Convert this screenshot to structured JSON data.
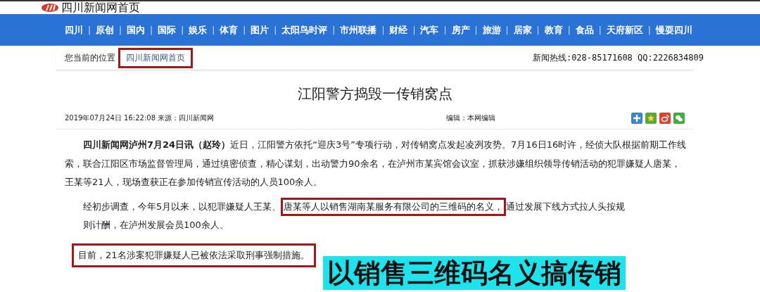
{
  "header": {
    "site_title": "四川新闻网首页"
  },
  "nav": {
    "items": [
      "四川",
      "原创",
      "国内",
      "国际",
      "娱乐",
      "体育",
      "图片",
      "太阳鸟时评",
      "市州联播",
      "财经",
      "汽车",
      "房产",
      "旅游",
      "居家",
      "教育",
      "食品",
      "天府新区",
      "慢耍四川"
    ],
    "separator": "|"
  },
  "breadcrumb": {
    "label": "您当前的位置",
    "link": "四川新闻网首页",
    "boxed": true,
    "hotline": "新闻热线:028-85171608 QQ:2226834809"
  },
  "article": {
    "title": "江阳警方捣毁一传销窝点",
    "published": "2019年07月24日 16:22:08 来源：四川新闻网",
    "editor": "编辑：本网编辑",
    "share_icons": [
      {
        "kind": "add",
        "color": "#3a86c8"
      },
      {
        "kind": "star",
        "color": "#5aa83a"
      },
      {
        "kind": "weibo",
        "color": "#d9442f"
      },
      {
        "kind": "wechat",
        "color": "#3fae3a"
      }
    ],
    "lead": "**四川新闻网泸州7月24日讯（赵玲）**近日，江阳警方依托“迎庆3号”专项行动，对传销窝点发起凌冽攻势。7月16日16时许，经侦大队根据前期工作线索，联合江阳区市场监督管理局，通过缜密侦查，精心谋划，出动警力90余名，在泸州市某宾馆会议室，抓获涉嫌组织领导传销活动的犯罪嫌疑人唐某，王某等21人，现场查获正在参加传销宣传活动的人员100余人。",
    "finding_segments": [
      {
        "text": "经初步调查，今年5月以来，以犯罪嫌疑人王某、",
        "boxed": false
      },
      {
        "text": "唐某等人以销售湖南某服务有限公司的三维码的名义，",
        "boxed": true
      },
      {
        "text": "通过发展下线方式拉人头按规",
        "boxed": false
      },
      {
        "text": "则计酬，在泸州发展会员100余人。",
        "boxed": false
      }
    ],
    "conclusion": {
      "text": "目前，21名涉案犯罪嫌疑人已被依法采取刑事强制措施。",
      "boxed": true
    }
  },
  "caption_banner": {
    "text": "以销售三维码名义搞传销"
  }
}
